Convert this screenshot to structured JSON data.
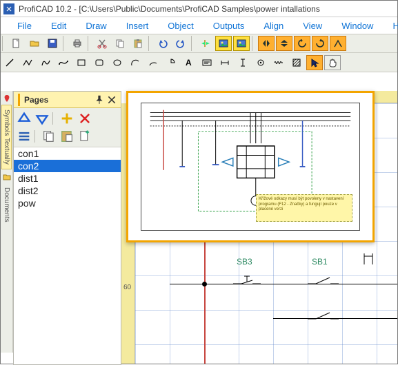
{
  "title": "ProfiCAD 10.2 - [C:\\Users\\Public\\Documents\\ProfiCAD Samples\\power intallations",
  "menu": {
    "items": [
      "File",
      "Edit",
      "Draw",
      "Insert",
      "Object",
      "Outputs",
      "Align",
      "View",
      "Window",
      "He"
    ]
  },
  "side_tabs": {
    "symbols": "Symbols Textually",
    "documents": "Documents"
  },
  "pages_panel": {
    "title": "Pages",
    "items": [
      "con1",
      "con2",
      "dist1",
      "dist2",
      "pow"
    ],
    "selected_index": 1
  },
  "ruler": {
    "v_tick_60": "60"
  },
  "schematic": {
    "labels": {
      "sb3": "SB3",
      "sb1": "SB1"
    }
  },
  "preview": {
    "note": "Křížové odkazy musí být povoleny v nastavení programu (F12 - Značky) a fungují pouze v placené verzi"
  },
  "icons": {
    "new": "new",
    "open": "open",
    "save": "save",
    "print": "print",
    "cut": "cut",
    "copy": "copy",
    "paste": "paste",
    "undo": "undo",
    "redo": "redo",
    "wizard": "wizard",
    "img1": "image",
    "img2": "image",
    "flip_h": "flip-h",
    "flip_v": "flip-v",
    "rot_l": "rotate-left",
    "rot_r": "rotate-right",
    "line": "line",
    "polyline": "polyline",
    "curve": "curve",
    "freehand": "freehand",
    "rect": "rect",
    "rrect": "round-rect",
    "ellipse": "ellipse",
    "arc1": "arc",
    "arc2": "arc",
    "pie": "pie",
    "text": "text",
    "textbox": "textbox",
    "dim": "dimension",
    "dim2": "dimension-v",
    "snap": "snap",
    "coil": "coil",
    "hatch": "hatch",
    "pointer": "pointer",
    "hand": "hand"
  }
}
